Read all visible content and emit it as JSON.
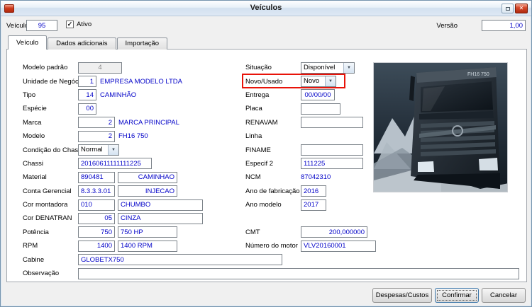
{
  "titlebar": {
    "title": "Veículos"
  },
  "icons": {
    "close": "✕",
    "dropdown": "▼",
    "check": "✓"
  },
  "header": {
    "vehicle_label": "Veículo",
    "vehicle_value": "95",
    "active_label": "Ativo",
    "active_checked": true,
    "version_label": "Versão",
    "version_value": "1,00"
  },
  "tabs": {
    "vehicle": "Veículo",
    "additional": "Dados adicionais",
    "import": "Importação"
  },
  "left": {
    "modelo_padrao": {
      "label": "Modelo padrão",
      "value": "4"
    },
    "unidade_negocio": {
      "label": "Unidade de Negócio",
      "code": "1",
      "desc": "EMPRESA MODELO LTDA"
    },
    "tipo": {
      "label": "Tipo",
      "code": "14",
      "desc": "CAMINHÃO"
    },
    "especie": {
      "label": "Espécie",
      "code": "00"
    },
    "marca": {
      "label": "Marca",
      "code": "2",
      "desc": "MARCA PRINCIPAL"
    },
    "modelo": {
      "label": "Modelo",
      "code": "2",
      "desc": "FH16 750"
    },
    "condicao_chassi": {
      "label": "Condição do Chassi",
      "value": "Normal"
    },
    "chassi": {
      "label": "Chassi",
      "value": "20160611111111225"
    },
    "material": {
      "label": "Material",
      "code": "890481",
      "desc": "CAMINHAO"
    },
    "conta_gerencial": {
      "label": "Conta Gerencial",
      "code": "8.3.3.3.01",
      "desc": "INJECAO"
    },
    "cor_montadora": {
      "label": "Cor montadora",
      "code": "010",
      "desc": "CHUMBO"
    },
    "cor_denatran": {
      "label": "Cor DENATRAN",
      "code": "05",
      "desc": "CINZA"
    },
    "potencia": {
      "label": "Potência",
      "code": "750",
      "desc": "750 HP"
    },
    "rpm": {
      "label": "RPM",
      "code": "1400",
      "desc": "1400 RPM"
    },
    "cabine": {
      "label": "Cabine",
      "value": "GLOBETX750"
    },
    "observacao": {
      "label": "Observação",
      "value": ""
    }
  },
  "right": {
    "situacao": {
      "label": "Situação",
      "value": "Disponível"
    },
    "novo_usado": {
      "label": "Novo/Usado",
      "value": "Novo"
    },
    "entrega": {
      "label": "Entrega",
      "value": "00/00/00"
    },
    "placa": {
      "label": "Placa",
      "value": ""
    },
    "renavam": {
      "label": "RENAVAM",
      "value": ""
    },
    "linha": {
      "label": "Linha",
      "value": ""
    },
    "finame": {
      "label": "FINAME",
      "value": ""
    },
    "especif2": {
      "label": "Especif 2",
      "value": "111225"
    },
    "ncm": {
      "label": "NCM",
      "value": "87042310"
    },
    "ano_fabricacao": {
      "label": "Ano de fabricação",
      "value": "2016"
    },
    "ano_modelo": {
      "label": "Ano modelo",
      "value": "2017"
    },
    "cmt": {
      "label": "CMT",
      "value": "200,000000"
    },
    "numero_motor": {
      "label": "Número do motor",
      "value": "VLV20160001"
    }
  },
  "photo": {
    "badge": "FH16 750"
  },
  "footer": {
    "despesas": "Despesas/Custos",
    "confirmar": "Confirmar",
    "cancelar": "Cancelar"
  }
}
